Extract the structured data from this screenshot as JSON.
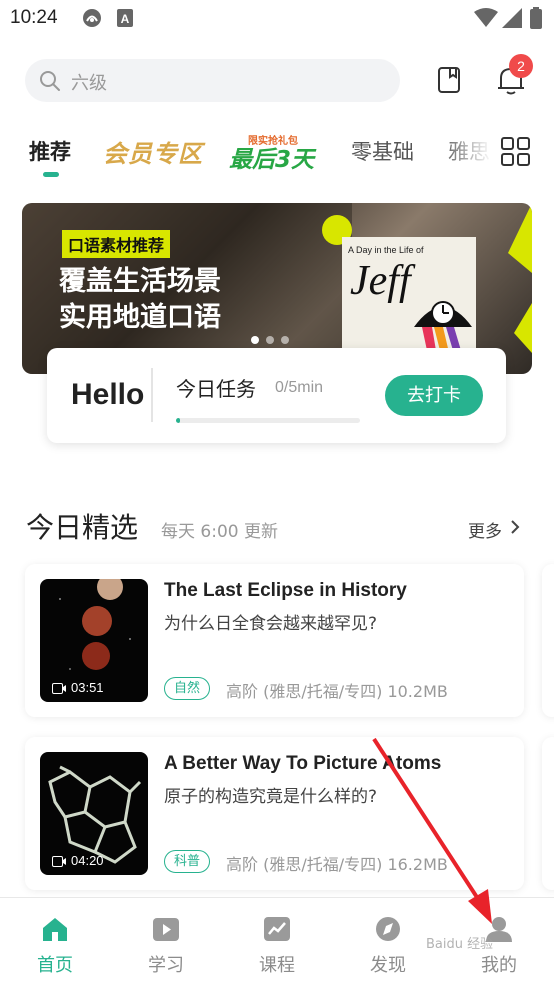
{
  "status_bar": {
    "time": "10:24"
  },
  "search": {
    "placeholder": "六级",
    "notification_count": "2"
  },
  "tabs": {
    "items": [
      "推荐",
      "零基础",
      "雅思"
    ],
    "promo_vip": "会员专区",
    "promo_sale_small": "限实抢礼包",
    "promo_sale_big": "最后3天"
  },
  "banner": {
    "tag": "口语素材推荐",
    "line1": "覆盖生活场景",
    "line2": "实用地道口语",
    "book_subtitle": "A Day in the Life of",
    "book_title": "Jeff",
    "slide_count": 3,
    "active_slide": 0
  },
  "task": {
    "hello": "Hello",
    "title": "今日任务",
    "progress_text": "0/5min",
    "progress": 0.02,
    "button": "去打卡"
  },
  "section": {
    "title": "今日精选",
    "subtitle": "每天 6:00 更新",
    "more": "更多"
  },
  "cards": [
    {
      "title": "The Last Eclipse in History",
      "subtitle": "为什么日全食会越来越罕见?",
      "duration": "03:51",
      "tag": "自然",
      "meta": "高阶 (雅思/托福/专四)  10.2MB"
    },
    {
      "title": "A Better Way To Picture Atoms",
      "subtitle": "原子的构造究竟是什么样的?",
      "duration": "04:20",
      "tag": "科普",
      "meta": "高阶 (雅思/托福/专四)  16.2MB"
    }
  ],
  "bottom_nav": [
    {
      "label": "首页",
      "icon": "home-icon",
      "active": true
    },
    {
      "label": "学习",
      "icon": "play-icon",
      "active": false
    },
    {
      "label": "课程",
      "icon": "chart-icon",
      "active": false
    },
    {
      "label": "发现",
      "icon": "compass-icon",
      "active": false
    },
    {
      "label": "我的",
      "icon": "profile-icon",
      "active": false
    }
  ],
  "watermark": "Baidu 经验",
  "colors": {
    "accent": "#27b28f",
    "badge": "#f04a4a",
    "banner_tag": "#d8e600",
    "annotation": "#e8232a"
  }
}
